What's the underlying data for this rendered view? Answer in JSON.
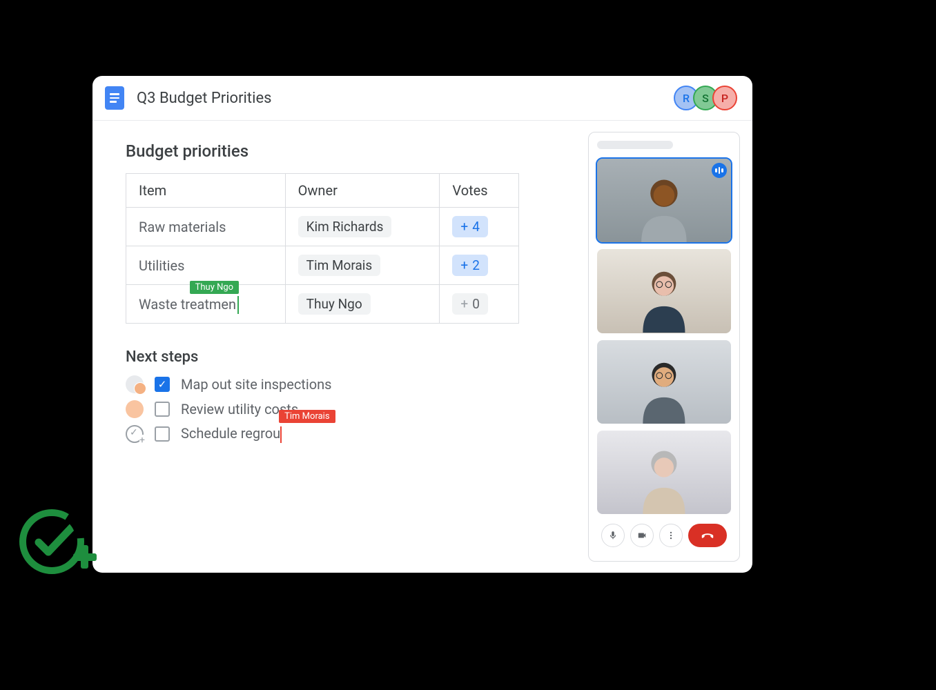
{
  "header": {
    "title": "Q3 Budget Priorities",
    "collaborators": [
      {
        "initial": "R",
        "classKey": "av-r"
      },
      {
        "initial": "S",
        "classKey": "av-s"
      },
      {
        "initial": "P",
        "classKey": "av-p"
      }
    ]
  },
  "doc": {
    "section_title": "Budget priorities",
    "columns": {
      "item": "Item",
      "owner": "Owner",
      "votes": "Votes"
    },
    "rows": [
      {
        "item": "Raw materials",
        "owner": "Kim Richards",
        "votes": "4",
        "voteStyle": "vote-blue"
      },
      {
        "item": "Utilities",
        "owner": "Tim Morais",
        "votes": "2",
        "voteStyle": "vote-blue"
      },
      {
        "item": "Waste treatmen",
        "owner": "Thuy Ngo",
        "votes": "0",
        "voteStyle": "vote-gray",
        "cursorUser": "Thuy Ngo"
      }
    ],
    "next_title": "Next steps",
    "steps": [
      {
        "text": "Map out site inspections",
        "checked": true,
        "assignee": "multi"
      },
      {
        "text": "Review utility costs",
        "checked": false,
        "assignee": "single"
      },
      {
        "text": "Schedule regrou",
        "checked": false,
        "assignee": "add",
        "cursorUser": "Tim Morais"
      }
    ]
  },
  "meet": {
    "participants": [
      {
        "speaking": true,
        "skin": "#8d5524",
        "shirt": "#9fa8ad"
      },
      {
        "speaking": false,
        "skin": "#e8beac",
        "shirt": "#2c3e50"
      },
      {
        "speaking": false,
        "skin": "#e0ac7e",
        "shirt": "#5a6670"
      },
      {
        "speaking": false,
        "skin": "#e8c9b8",
        "shirt": "#d4c5b0"
      }
    ],
    "controls": {
      "mic": "mic-icon",
      "video": "video-icon",
      "more": "more-icon",
      "end": "end-call-icon"
    }
  }
}
